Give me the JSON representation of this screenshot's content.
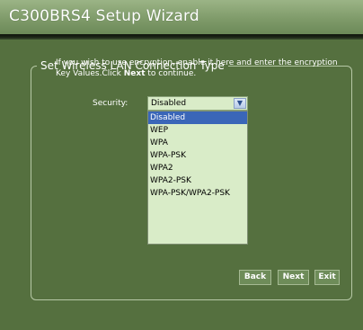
{
  "window": {
    "title": "C300BRS4 Setup Wizard"
  },
  "section": {
    "legend": "Set Wireless LAN Connection Type"
  },
  "instructions": {
    "line1": "If you wish to use encryption, enable it here and enter the encryption",
    "line2_prefix": "Key Values.Click ",
    "line2_bold": "Next",
    "line2_suffix": " to continue."
  },
  "security": {
    "label": "Security:",
    "selected": "Disabled",
    "arrow_icon": "chevron-down-icon",
    "options": [
      "Disabled",
      "WEP",
      "WPA",
      "WPA-PSK",
      "WPA2",
      "WPA2-PSK",
      "WPA-PSK/WPA2-PSK"
    ],
    "highlighted_index": 0
  },
  "buttons": {
    "back": "Back",
    "next": "Next",
    "exit": "Exit"
  },
  "colors": {
    "background": "#55703f",
    "titlebar": "#7f9b6a",
    "highlight": "#3a66b8",
    "field": "#d9ecc8"
  }
}
